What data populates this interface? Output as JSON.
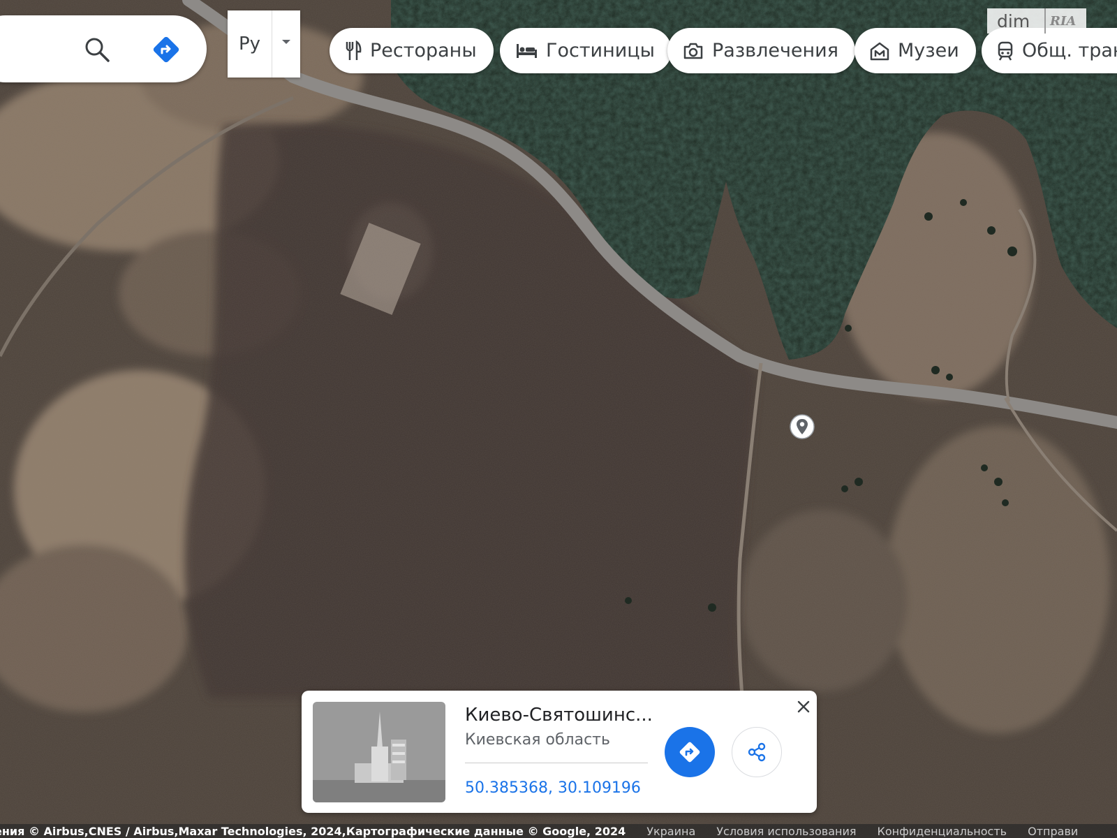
{
  "search": {
    "icon": "search-icon",
    "directions_icon": "directions-icon"
  },
  "language": {
    "label": "Ру",
    "caret_icon": "caret-down-icon"
  },
  "categories": [
    {
      "label": "Рестораны",
      "icon": "restaurant-icon"
    },
    {
      "label": "Гостиницы",
      "icon": "hotel-icon"
    },
    {
      "label": "Развлечения",
      "icon": "camera-icon"
    },
    {
      "label": "Музеи",
      "icon": "museum-icon"
    },
    {
      "label": "Общ. тран",
      "icon": "transit-icon"
    }
  ],
  "watermark": {
    "left": "dim",
    "right": "RIA"
  },
  "place_card": {
    "title": "Киево-Святошинс...",
    "subtitle": "Киевская область",
    "coordinates": "50.385368, 30.109196",
    "directions_icon": "directions-icon",
    "share_icon": "share-icon",
    "close_icon": "close-icon"
  },
  "footer": {
    "attribution": "ения © Airbus,CNES / Airbus,Maxar Technologies, 2024,Картографические данные © Google, 2024",
    "links": [
      "Украина",
      "Условия использования",
      "Конфиденциальность",
      "Отправи"
    ]
  },
  "colors": {
    "accent": "#1a73e8",
    "field": "#4a4038",
    "forest": "#1b2e24",
    "dry_grass": "#8a7866",
    "road": "#8b8886"
  }
}
